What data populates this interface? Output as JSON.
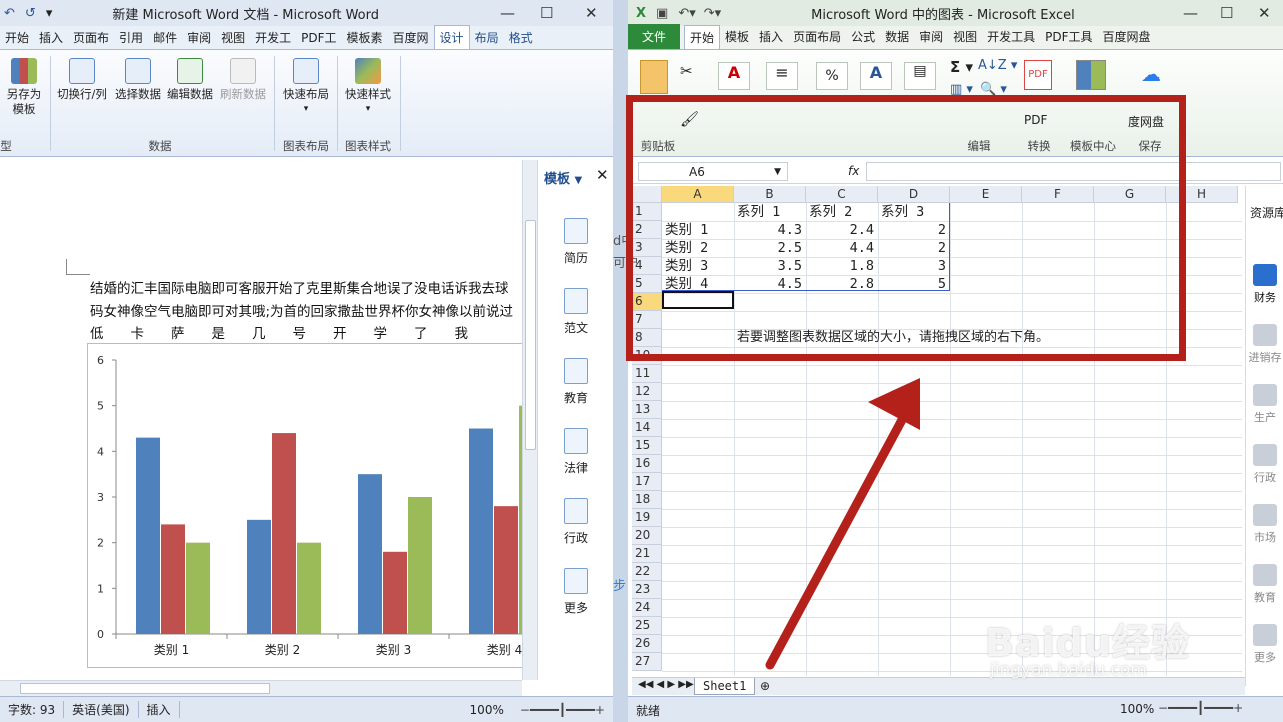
{
  "word": {
    "title": "新建 Microsoft Word 文档 - Microsoft Word",
    "tabs": [
      "开始",
      "插入",
      "页面布",
      "引用",
      "邮件",
      "审阅",
      "视图",
      "开发工",
      "PDF工",
      "模板素",
      "百度网",
      "设计",
      "布局",
      "格式"
    ],
    "ribbon": {
      "save_template": "另存为\n模板",
      "switch": "切换行/列",
      "select_data": "选择数据",
      "edit_data": "编辑数据",
      "refresh_data": "刷新数据",
      "quick_layout": "快速布局",
      "quick_style": "快速样式",
      "group_data": "数据",
      "group_layout": "图表布局",
      "group_style": "图表样式",
      "group_left": "型"
    },
    "doc_lines": [
      "结婚的汇丰国际电脑即可客服开始了克里斯集合地误了没电话诉我去球",
      "码女神像空气电脑即可对其哦;为首的回家撒盐世界杯你女神像以前说过",
      "低　　卡　　萨　　是　　几　　号　　开　　学　　了　　我"
    ],
    "pane": {
      "title": "模板",
      "items": [
        "简历",
        "范文",
        "教育",
        "法律",
        "行政",
        "更多"
      ]
    },
    "status": {
      "words": "字数: 93",
      "lang": "英语(美国)",
      "mode": "插入",
      "zoom": "100%"
    }
  },
  "chart_data": {
    "type": "bar",
    "categories": [
      "类别 1",
      "类别 2",
      "类别 3",
      "类别 4"
    ],
    "series": [
      {
        "values": [
          4.3,
          2.5,
          3.5,
          4.5
        ],
        "color": "#4f81bd"
      },
      {
        "values": [
          2.4,
          4.4,
          1.8,
          2.8
        ],
        "color": "#c0504d"
      },
      {
        "values": [
          2,
          2,
          3,
          5
        ],
        "color": "#9bbb59"
      }
    ],
    "ylim": [
      0,
      6
    ],
    "yticks": [
      "0",
      "1",
      "2",
      "3",
      "4",
      "5",
      "6"
    ],
    "grid": false
  },
  "excel": {
    "title": "Microsoft Word 中的图表 - Microsoft Excel",
    "file_tab": "文件",
    "tabs": [
      "开始",
      "模板",
      "插入",
      "页面布局",
      "公式",
      "数据",
      "审阅",
      "视图",
      "开发工具",
      "PDF工具",
      "百度网盘"
    ],
    "ribbon": {
      "pdf_label": "PDF",
      "baidu_label": "度网盘",
      "clipboard": "剪贴板",
      "edit": "编辑",
      "convert": "转换",
      "template_center": "模板中心",
      "save": "保存"
    },
    "namebox": "A6",
    "fx": "fx",
    "columns": [
      "A",
      "B",
      "C",
      "D",
      "E",
      "F",
      "G",
      "H"
    ],
    "rows": [
      "1",
      "2",
      "3",
      "4",
      "5",
      "6",
      "7",
      "8",
      "10",
      "11",
      "12",
      "13",
      "14",
      "15",
      "16",
      "17",
      "18",
      "19",
      "20",
      "21",
      "22",
      "23",
      "24",
      "25",
      "26",
      "27"
    ],
    "cells": {
      "b1": "系列 1",
      "c1": "系列 2",
      "d1": "系列 3",
      "a2": "类别 1",
      "b2": "4.3",
      "c2": "2.4",
      "d2": "2",
      "a3": "类别 2",
      "b3": "2.5",
      "c3": "4.4",
      "d3": "2",
      "a4": "类别 3",
      "b4": "3.5",
      "c4": "1.8",
      "d4": "3",
      "a5": "类别 4",
      "b5": "4.5",
      "c5": "2.8",
      "d5": "5",
      "b8": "若要调整图表数据区域的大小，请拖拽区域的右下角。"
    },
    "sheet_tab": "Sheet1",
    "status": {
      "ready": "就绪",
      "zoom": "100%"
    },
    "side": {
      "title": "资源库",
      "items": [
        "财务",
        "进销存",
        "生产",
        "行政",
        "市场",
        "教育",
        "更多"
      ]
    }
  },
  "partial": {
    "w1": "d中",
    "w2": "可户",
    "w3": "步"
  },
  "watermark": {
    "brand": "Baidu经验",
    "url": "jingyan.baidu.com"
  },
  "colors": {
    "highlight": "#b4201a",
    "excel_green": "#2c8a3a"
  }
}
